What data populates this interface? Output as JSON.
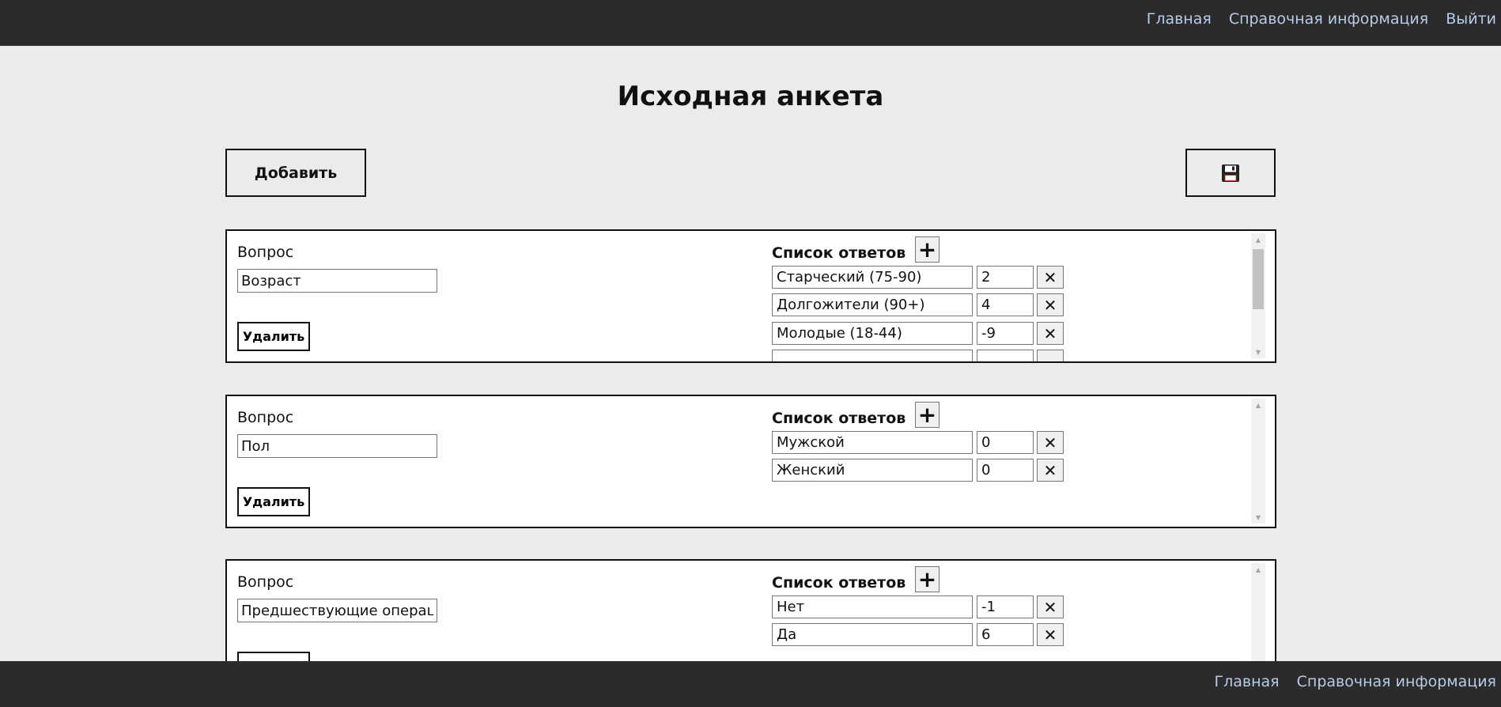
{
  "nav": {
    "home": "Главная",
    "help": "Справочная информация",
    "logout": "Выйти"
  },
  "page": {
    "title": "Исходная анкета",
    "add_label": "Добавить",
    "save_icon": "floppy-disk-icon"
  },
  "labels": {
    "question": "Вопрос",
    "answers": "Список ответов",
    "delete": "Удалить",
    "plus": "+",
    "remove": "✕"
  },
  "questions": [
    {
      "text": "Возраст",
      "answers": [
        {
          "text": "Старческий (75-90)",
          "score": "2"
        },
        {
          "text": "Долгожители (90+)",
          "score": "4"
        },
        {
          "text": "Молодые (18-44)",
          "score": "-9"
        }
      ]
    },
    {
      "text": "Пол",
      "answers": [
        {
          "text": "Мужской",
          "score": "0"
        },
        {
          "text": "Женский",
          "score": "0"
        }
      ]
    },
    {
      "text": "Предшествующие операции",
      "answers": [
        {
          "text": "Нет",
          "score": "-1"
        },
        {
          "text": "Да",
          "score": "6"
        }
      ]
    }
  ],
  "footer": {
    "home": "Главная",
    "help": "Справочная информация"
  }
}
